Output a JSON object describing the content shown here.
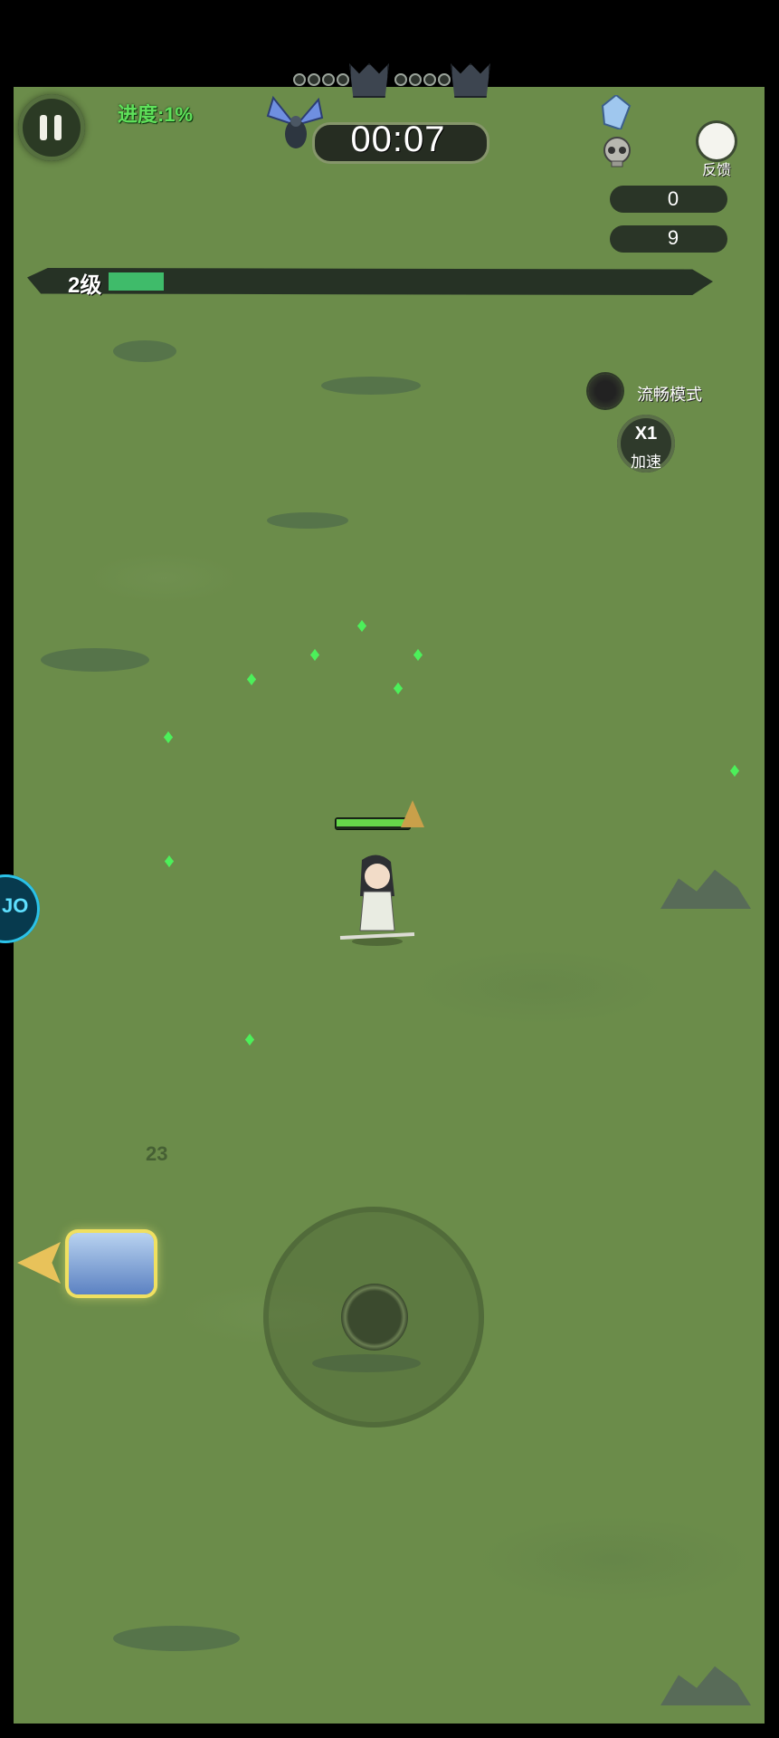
{
  "hud": {
    "progress_text": "进度:1%",
    "timer": "00:07",
    "level_label": "2级",
    "level_progress": 0.08,
    "feedback_label": "反馈",
    "smooth_mode_label": "流畅模式",
    "speed_multiplier": "X1",
    "speed_label": "加速"
  },
  "resources": {
    "crystals": "0",
    "kills": "9"
  },
  "player": {
    "health_fraction": 0.95
  },
  "floor_number": "23",
  "overlay_badge": "JO",
  "colors": {
    "grass": "#6b8c4a",
    "accent_green": "#5fe05a",
    "level_fill": "#3fbb6a",
    "chest_glow": "#f0e060"
  },
  "icons": [
    "pause-icon",
    "moth-boss-icon",
    "crystal-icon",
    "skull-icon",
    "feedback-icon",
    "treasure-chest-icon",
    "joystick"
  ]
}
